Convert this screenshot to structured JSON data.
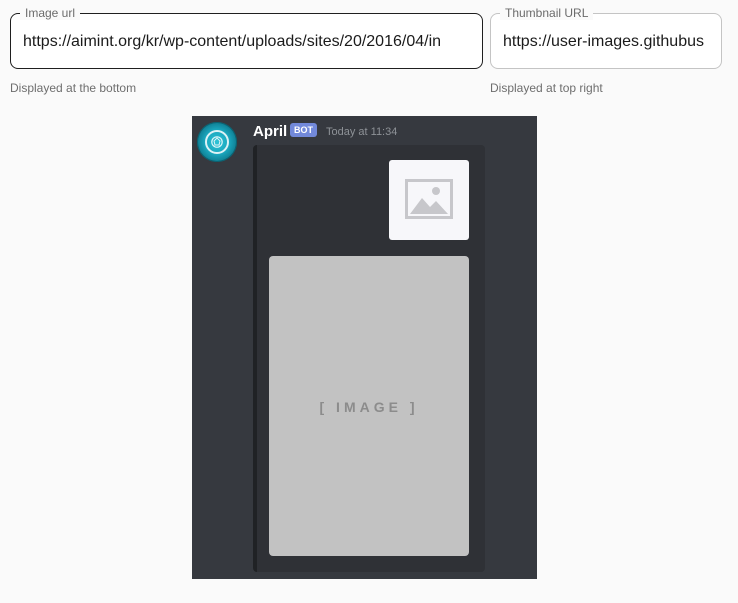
{
  "fields": {
    "image_url": {
      "label": "Image url",
      "value": "https://aimint.org/kr/wp-content/uploads/sites/20/2016/04/in",
      "helper": "Displayed at the bottom"
    },
    "thumbnail_url": {
      "label": "Thumbnail URL",
      "value": "https://user-images.githubus",
      "helper": "Displayed at top right"
    }
  },
  "preview": {
    "username": "April",
    "bot_tag": "BOT",
    "timestamp": "Today at 11:34",
    "image_placeholder": "[ IMAGE ]",
    "colors": {
      "background": "#36393f",
      "embed_background": "#2f3136",
      "embed_border": "#202225",
      "bot_tag": "#7289da",
      "avatar": "#19a4bb",
      "image_placeholder": "#c2c2c2"
    },
    "icons": {
      "avatar": "bot-avatar-icon",
      "thumbnail": "image-placeholder-icon"
    }
  }
}
